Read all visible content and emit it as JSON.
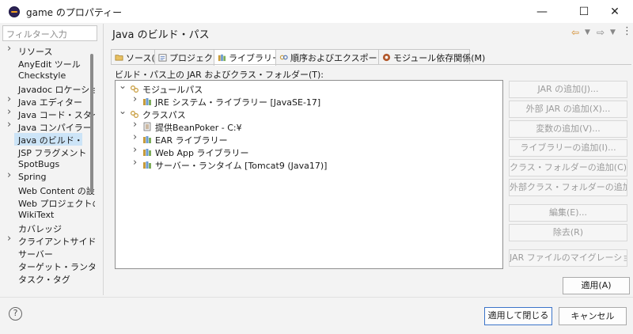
{
  "window": {
    "title": "game のプロパティー",
    "minimize": "—",
    "maximize": "☐",
    "close": "✕"
  },
  "sidebar": {
    "filter_placeholder": "フィルター入力",
    "items": [
      {
        "label": "リソース",
        "expandable": true
      },
      {
        "label": "AnyEdit ツール",
        "expandable": false
      },
      {
        "label": "Checkstyle",
        "expandable": false
      },
      {
        "label": "Javadoc ロケーション",
        "expandable": false
      },
      {
        "label": "Java エディター",
        "expandable": true
      },
      {
        "label": "Java コード・スタイル",
        "expandable": true
      },
      {
        "label": "Java コンパイラー",
        "expandable": true
      },
      {
        "label": "Java のビルド・パス",
        "expandable": false,
        "selected": true
      },
      {
        "label": "JSP フラグメント",
        "expandable": false
      },
      {
        "label": "SpotBugs",
        "expandable": false
      },
      {
        "label": "Spring",
        "expandable": true
      },
      {
        "label": "Web Content の設",
        "expandable": false
      },
      {
        "label": "Web プロジェクトの設",
        "expandable": false
      },
      {
        "label": "WikiText",
        "expandable": false
      },
      {
        "label": "カバレッジ",
        "expandable": false
      },
      {
        "label": "クライアントサイド Jav",
        "expandable": true
      },
      {
        "label": "サーバー",
        "expandable": false
      },
      {
        "label": "ターゲット・ランタイム",
        "expandable": false
      },
      {
        "label": "タスク・タグ",
        "expandable": false
      }
    ]
  },
  "header": {
    "title": "Java のビルド・パス"
  },
  "tabs": [
    {
      "label": "ソース(S)",
      "active": false
    },
    {
      "label": "プロジェクト(P)",
      "active": false
    },
    {
      "label": "ライブラリー(L)",
      "active": true
    },
    {
      "label": "順序およびエクスポート(O)",
      "active": false
    },
    {
      "label": "モジュール依存関係(M)",
      "active": false
    }
  ],
  "main": {
    "jar_label": "ビルド・パス上の JAR およびクラス・フォルダー(T):",
    "tree": [
      {
        "label": "モジュールパス",
        "level": 0,
        "expanded": true,
        "icon": "path-icon"
      },
      {
        "label": "JRE システム・ライブラリー [JavaSE-17]",
        "level": 1,
        "expanded": false,
        "icon": "library-icon"
      },
      {
        "label": "クラスパス",
        "level": 0,
        "expanded": true,
        "icon": "path-icon"
      },
      {
        "label": "提供BeanPoker - C:¥",
        "level": 1,
        "expanded": false,
        "icon": "jar-icon"
      },
      {
        "label": "EAR ライブラリー",
        "level": 1,
        "expanded": false,
        "icon": "library-icon"
      },
      {
        "label": "Web App ライブラリー",
        "level": 1,
        "expanded": false,
        "icon": "library-icon"
      },
      {
        "label": "サーバー・ランタイム [Tomcat9 (Java17)]",
        "level": 1,
        "expanded": false,
        "icon": "library-icon"
      }
    ],
    "buttons": [
      "JAR の追加(J)...",
      "外部 JAR の追加(X)...",
      "変数の追加(V)...",
      "ライブラリーの追加(I)...",
      "クラス・フォルダーの追加(C)...",
      "外部クラス・フォルダーの追加(D)...",
      "編集(E)...",
      "除去(R)",
      "JAR ファイルのマイグレーション(M)..."
    ],
    "apply": "適用(A)"
  },
  "footer": {
    "help": "?",
    "apply_close": "適用して閉じる",
    "cancel": "キャンセル"
  },
  "colors": {
    "selection": "#cce4f7",
    "primary_border": "#3c74c9",
    "disabled_text": "#9c9c9c"
  }
}
